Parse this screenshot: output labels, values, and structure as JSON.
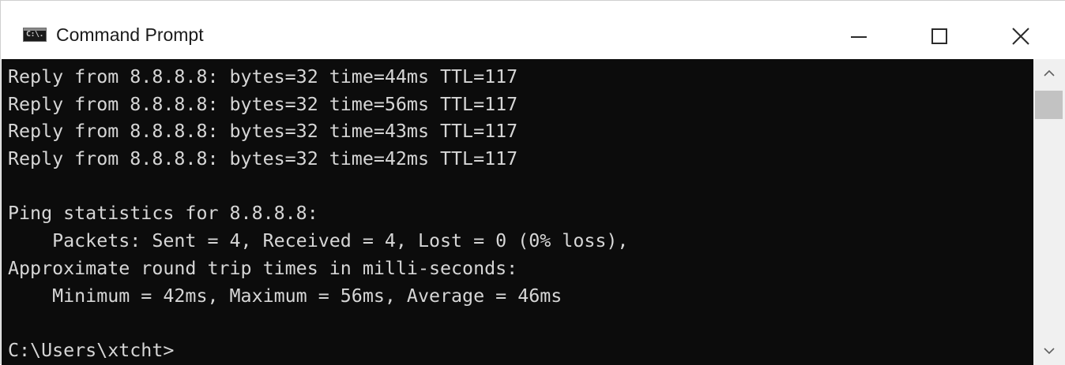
{
  "window": {
    "title": "Command Prompt",
    "icon": "cmd-icon",
    "icon_label": "C:\\.",
    "controls": {
      "minimize": "minimize-icon",
      "maximize": "maximize-icon",
      "close": "close-icon"
    }
  },
  "console": {
    "background_color": "#0c0c0c",
    "text_color": "#d6d6d6",
    "lines": [
      "Reply from 8.8.8.8: bytes=32 time=44ms TTL=117",
      "Reply from 8.8.8.8: bytes=32 time=56ms TTL=117",
      "Reply from 8.8.8.8: bytes=32 time=43ms TTL=117",
      "Reply from 8.8.8.8: bytes=32 time=42ms TTL=117",
      "",
      "Ping statistics for 8.8.8.8:",
      "    Packets: Sent = 4, Received = 4, Lost = 0 (0% loss),",
      "Approximate round trip times in milli-seconds:",
      "    Minimum = 42ms, Maximum = 56ms, Average = 46ms",
      "",
      "C:\\Users\\xtcht>"
    ]
  },
  "scrollbar": {
    "up_icon": "chevron-up-icon",
    "down_icon": "chevron-down-icon"
  }
}
